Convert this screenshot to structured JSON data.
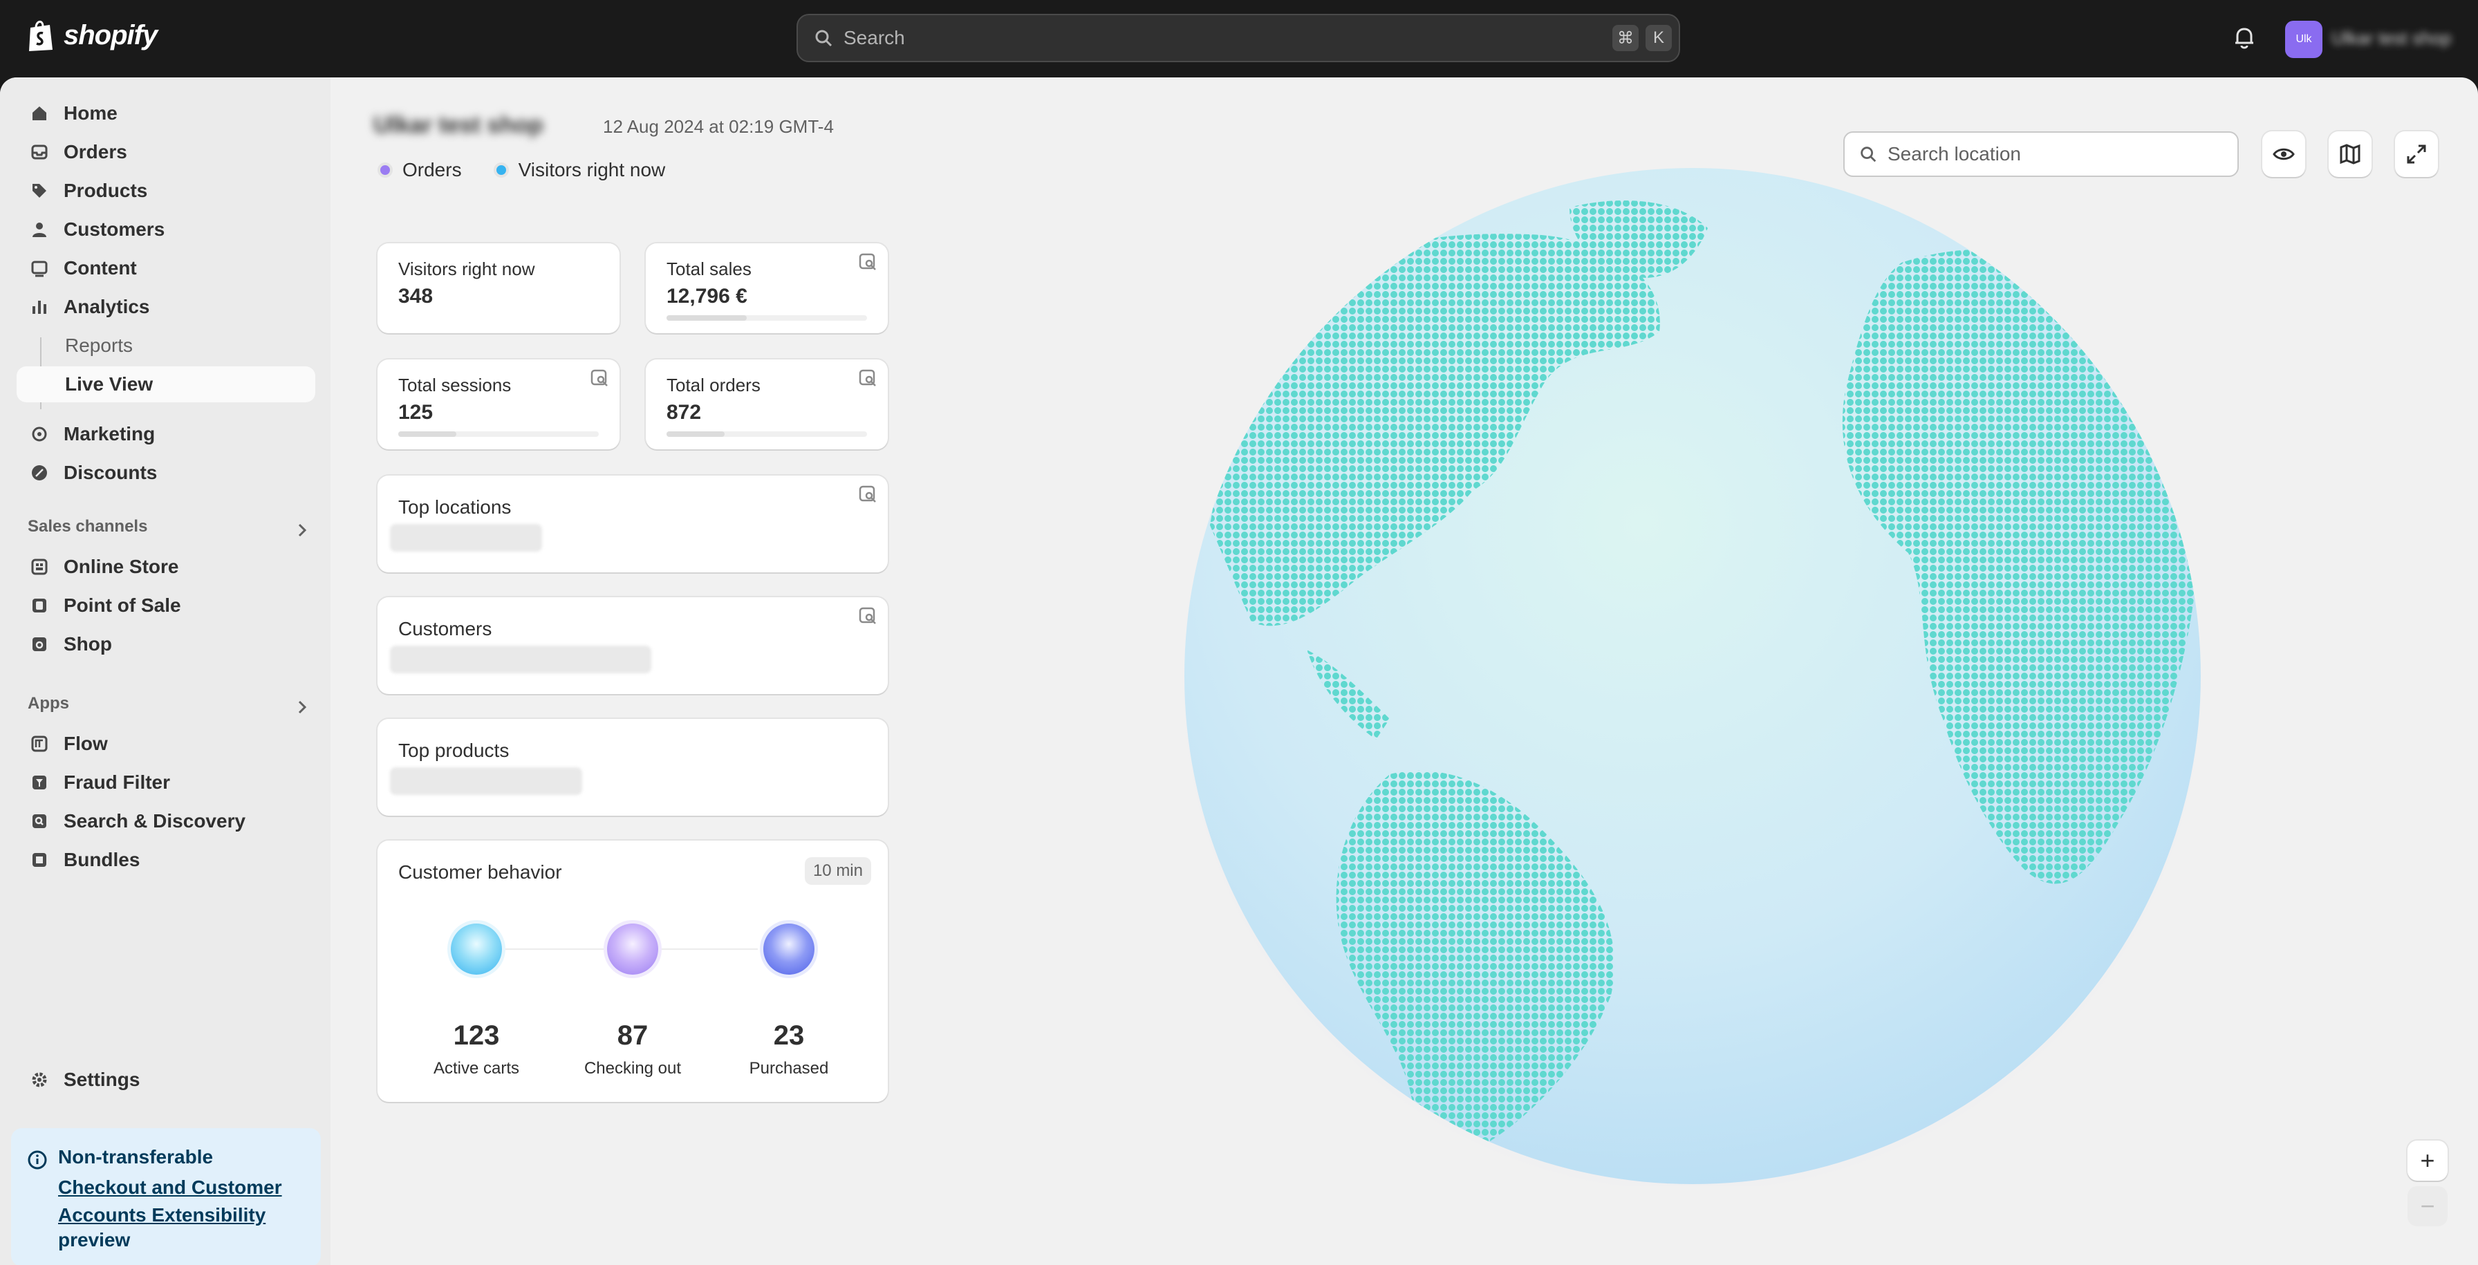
{
  "topbar": {
    "brand": "shopify",
    "search_placeholder": "Search",
    "shortcut_key1": "⌘",
    "shortcut_key2": "K",
    "avatar_initials": "Ulk",
    "account_name": "Ulkar test shop"
  },
  "sidebar": {
    "items": [
      {
        "label": "Home",
        "icon": "home-icon"
      },
      {
        "label": "Orders",
        "icon": "inbox-icon"
      },
      {
        "label": "Products",
        "icon": "tag-icon"
      },
      {
        "label": "Customers",
        "icon": "person-icon"
      },
      {
        "label": "Content",
        "icon": "image-icon"
      },
      {
        "label": "Analytics",
        "icon": "bar-chart-icon"
      },
      {
        "label": "Reports"
      },
      {
        "label": "Live View"
      },
      {
        "label": "Marketing",
        "icon": "target-icon"
      },
      {
        "label": "Discounts",
        "icon": "discount-icon"
      }
    ],
    "sales_channels_label": "Sales channels",
    "sales_channels": [
      {
        "label": "Online Store",
        "icon": "store-icon"
      },
      {
        "label": "Point of Sale",
        "icon": "pos-icon"
      },
      {
        "label": "Shop",
        "icon": "shop-icon"
      }
    ],
    "apps_label": "Apps",
    "apps": [
      {
        "label": "Flow",
        "icon": "flow-icon"
      },
      {
        "label": "Fraud Filter",
        "icon": "filter-icon"
      },
      {
        "label": "Search & Discovery",
        "icon": "search-app-icon"
      },
      {
        "label": "Bundles",
        "icon": "bundles-icon"
      }
    ],
    "settings_label": "Settings",
    "notice": {
      "title": "Non-transferable",
      "link": "Checkout and Customer Accounts Extensibility",
      "tail": "preview"
    }
  },
  "main": {
    "shop_name": "Ulkar test shop",
    "date": "12 Aug 2024 at 02:19 GMT-4",
    "legend": {
      "orders": "Orders",
      "visitors": "Visitors right now"
    },
    "colors": {
      "orders": "#9a7cf2",
      "visitors": "#36b3f0",
      "land": "#5fd8cf"
    },
    "metrics": {
      "visitors_label": "Visitors right now",
      "visitors_value": "348",
      "sales_label": "Total sales",
      "sales_value": "12,796 €",
      "sales_fill": 0.4,
      "sessions_label": "Total sessions",
      "sessions_value": "125",
      "sessions_fill": 0.29,
      "orders_label": "Total orders",
      "orders_value": "872",
      "orders_fill": 0.29
    },
    "top_locations": "Top locations",
    "customers": "Customers",
    "top_products": "Top products",
    "behavior": {
      "title": "Customer behavior",
      "badge": "10 min",
      "active_carts": "123",
      "active_carts_label": "Active carts",
      "checking_out": "87",
      "checking_out_label": "Checking out",
      "purchased": "23",
      "purchased_label": "Purchased"
    },
    "location_search_placeholder": "Search location",
    "zoom_in": "+",
    "zoom_out": "−"
  }
}
